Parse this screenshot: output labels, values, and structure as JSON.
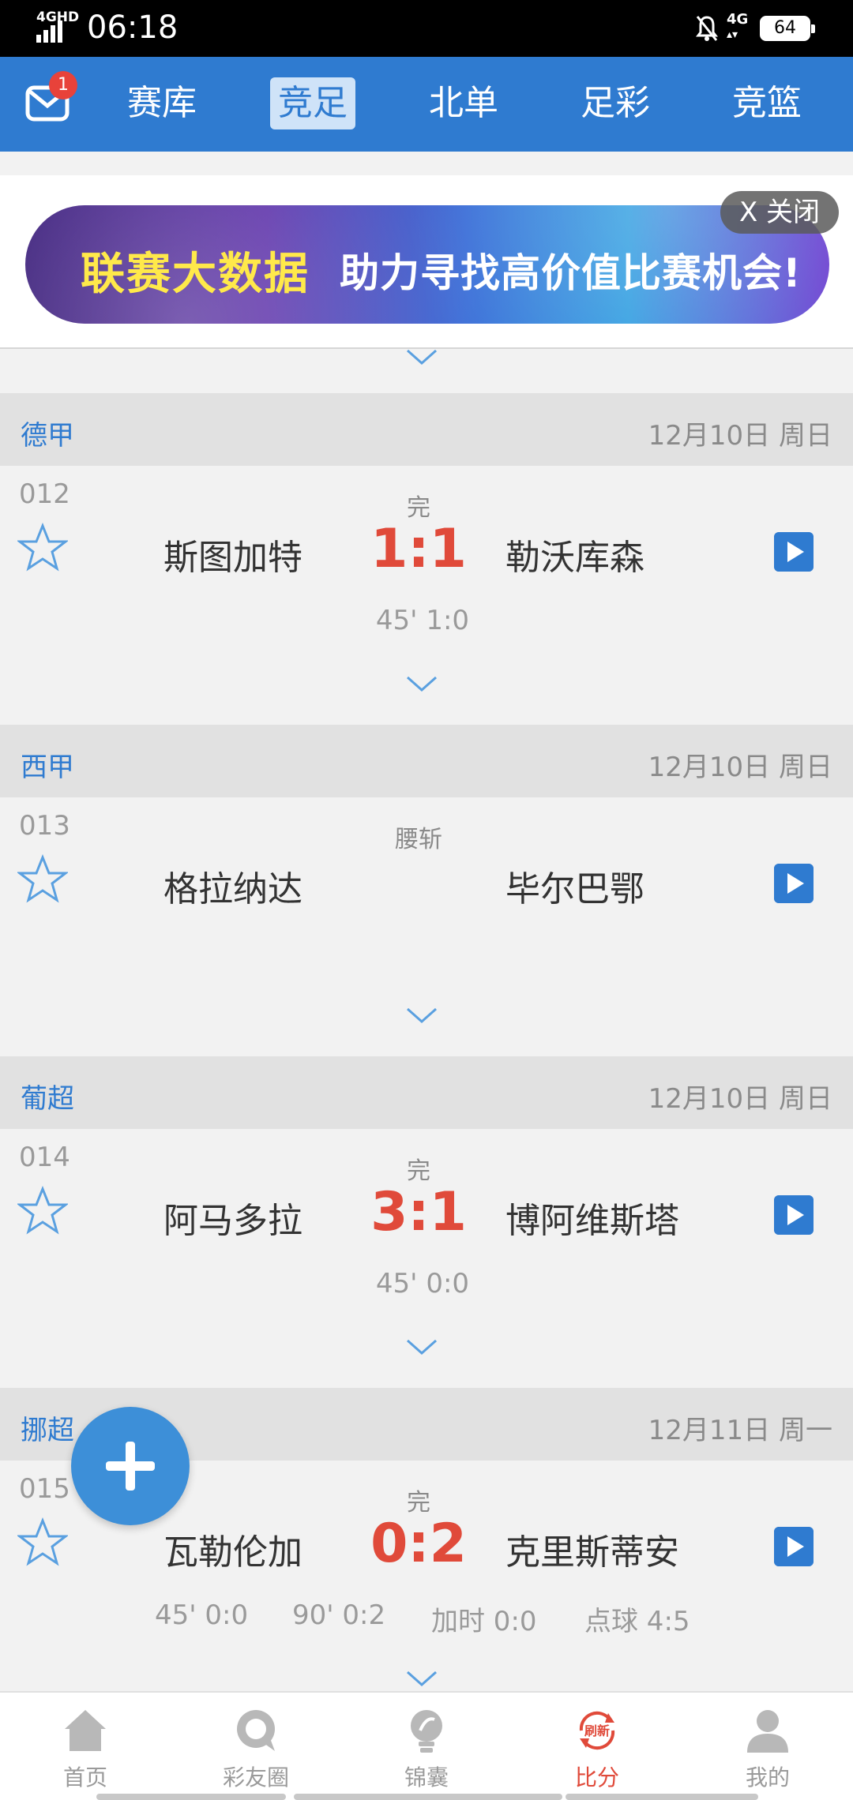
{
  "status_bar": {
    "time": "06:18",
    "network": "4G",
    "network_hd": "4GHD",
    "battery": "64"
  },
  "topnav": {
    "mail_badge": "1",
    "tabs": [
      {
        "label": "赛库",
        "active": false
      },
      {
        "label": "竞足",
        "active": true
      },
      {
        "label": "北单",
        "active": false
      },
      {
        "label": "足彩",
        "active": false
      },
      {
        "label": "竞篮",
        "active": false
      }
    ]
  },
  "banner": {
    "title": "联赛大数据",
    "subtitle": "助力寻找高价值比赛机会!",
    "close_label": "X 关闭"
  },
  "leagues": [
    {
      "name": "德甲",
      "date": "12月10日 周日"
    },
    {
      "name": "西甲",
      "date": "12月10日 周日"
    },
    {
      "name": "葡超",
      "date": "12月10日 周日"
    },
    {
      "name": "挪超",
      "date": "12月11日 周一"
    }
  ],
  "matches": [
    {
      "number": "012",
      "home": "斯图加特",
      "away": "勒沃库森",
      "status": "完",
      "score": "1:1",
      "half": "45' 1:0"
    },
    {
      "number": "013",
      "home": "格拉纳达",
      "away": "毕尔巴鄂",
      "status": "腰斩",
      "score": "",
      "half": ""
    },
    {
      "number": "014",
      "home": "阿马多拉",
      "away": "博阿维斯塔",
      "status": "完",
      "score": "3:1",
      "half": "45' 0:0"
    },
    {
      "number": "015",
      "home": "瓦勒伦加",
      "away": "克里斯蒂安",
      "status": "完",
      "score": "0:2",
      "extra": [
        "45' 0:0",
        "90' 0:2",
        "加时 0:0",
        "点球 4:5"
      ]
    }
  ],
  "bottom_nav": [
    {
      "label": "首页",
      "icon": "home-icon",
      "active": false
    },
    {
      "label": "彩友圈",
      "icon": "chat-bubble-icon",
      "active": false
    },
    {
      "label": "锦囊",
      "icon": "bulb-icon",
      "active": false
    },
    {
      "label": "比分",
      "icon": "refresh-icon",
      "icon_text": "刷新",
      "active": true
    },
    {
      "label": "我的",
      "icon": "person-icon",
      "active": false
    }
  ],
  "colors": {
    "brand_blue": "#2f7bd0",
    "score_red": "#e04a3a"
  }
}
